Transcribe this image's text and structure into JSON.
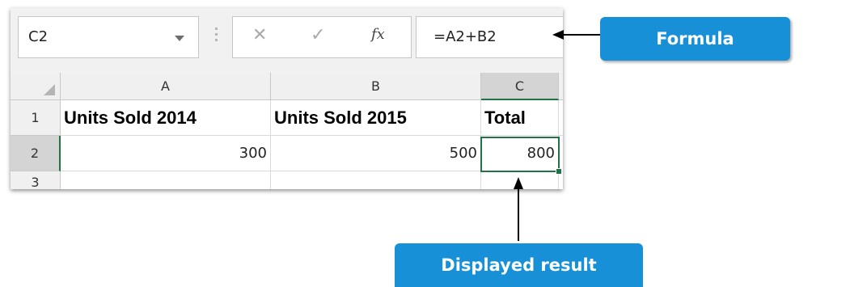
{
  "namebox": {
    "value": "C2",
    "dropdown_icon": "chevron-down-icon"
  },
  "formula_bar": {
    "cancel_icon": "close-icon",
    "cancel_glyph": "✕",
    "enter_icon": "check-icon",
    "enter_glyph": "✓",
    "fx_icon": "function-icon",
    "fx_label": "fx",
    "formula": "=A2+B2"
  },
  "columns": [
    "A",
    "B",
    "C"
  ],
  "selected_column": "C",
  "rows": [
    {
      "num": "1",
      "cells": [
        "Units Sold 2014",
        "Units Sold 2015",
        "Total"
      ]
    },
    {
      "num": "2",
      "cells": [
        "300",
        "500",
        "800"
      ]
    },
    {
      "num": "3",
      "cells": [
        "",
        "",
        ""
      ]
    }
  ],
  "selected_cell": "C2",
  "callouts": {
    "formula": "Formula",
    "result": "Displayed result",
    "color": "#1790d8"
  },
  "accent_color": "#217346"
}
